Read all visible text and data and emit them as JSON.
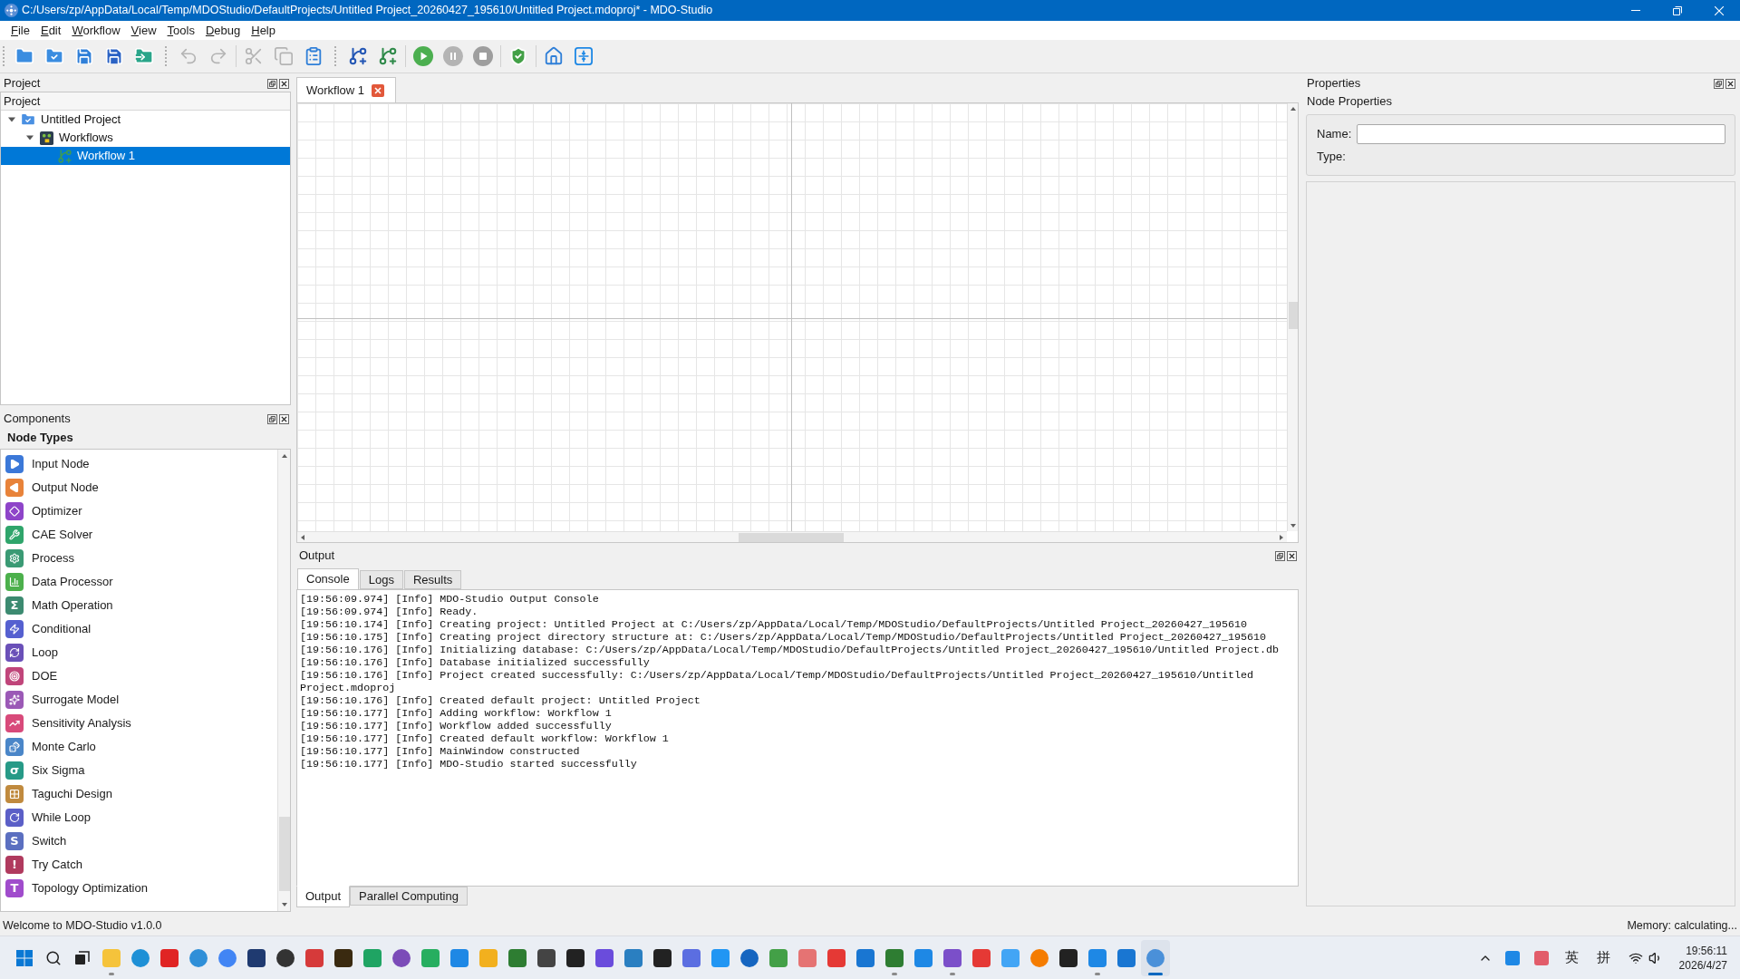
{
  "window": {
    "title": "C:/Users/zp/AppData/Local/Temp/MDOStudio/DefaultProjects/Untitled Project_20260427_195610/Untitled Project.mdoproj* - MDO-Studio"
  },
  "menu": [
    "File",
    "Edit",
    "Workflow",
    "View",
    "Tools",
    "Debug",
    "Help"
  ],
  "toolbar": [
    [
      {
        "kind": "new-project",
        "disabled": false
      },
      {
        "kind": "open-project",
        "disabled": false
      },
      {
        "kind": "save",
        "disabled": false
      },
      {
        "kind": "save-as",
        "disabled": false
      },
      {
        "kind": "export",
        "disabled": false
      }
    ],
    [
      {
        "kind": "undo",
        "disabled": true
      },
      {
        "kind": "redo",
        "disabled": true
      }
    ],
    [
      {
        "kind": "cut",
        "disabled": true
      },
      {
        "kind": "copy",
        "disabled": true
      },
      {
        "kind": "paste",
        "disabled": false
      }
    ],
    [
      {
        "kind": "add-workflow",
        "disabled": false
      },
      {
        "kind": "add-subworkflow",
        "disabled": false
      }
    ],
    [
      {
        "kind": "run",
        "disabled": false
      },
      {
        "kind": "pause",
        "disabled": true
      },
      {
        "kind": "stop",
        "disabled": true
      }
    ],
    [
      {
        "kind": "validate",
        "disabled": false
      }
    ],
    [
      {
        "kind": "home",
        "disabled": false
      },
      {
        "kind": "fit-view",
        "disabled": false
      }
    ]
  ],
  "project_panel": {
    "title": "Project",
    "column": "Project",
    "tree": [
      {
        "label": "Untitled Project",
        "expanded": true,
        "selected": false,
        "children": [
          {
            "label": "Workflows",
            "expanded": true,
            "selected": false,
            "children": [
              {
                "label": "Workflow 1",
                "selected": true
              }
            ]
          }
        ]
      }
    ]
  },
  "components_panel": {
    "title": "Components",
    "heading": "Node Types",
    "items": [
      {
        "label": "Input Node",
        "color": "#3b78d8"
      },
      {
        "label": "Output Node",
        "color": "#e8833a"
      },
      {
        "label": "Optimizer",
        "color": "#8e44c9"
      },
      {
        "label": "CAE Solver",
        "color": "#2fa56b"
      },
      {
        "label": "Process",
        "color": "#3a9a74"
      },
      {
        "label": "Data Processor",
        "color": "#4cb04c"
      },
      {
        "label": "Math Operation",
        "color": "#3c8a70",
        "glyph": "Σ"
      },
      {
        "label": "Conditional",
        "color": "#5560d0"
      },
      {
        "label": "Loop",
        "color": "#6a50b8"
      },
      {
        "label": "DOE",
        "color": "#c0457a"
      },
      {
        "label": "Surrogate Model",
        "color": "#9b59b6"
      },
      {
        "label": "Sensitivity Analysis",
        "color": "#d84a7a"
      },
      {
        "label": "Monte Carlo",
        "color": "#4a86c8"
      },
      {
        "label": "Six Sigma",
        "color": "#279a87",
        "glyph": "σ"
      },
      {
        "label": "Taguchi Design",
        "color": "#c08a3e"
      },
      {
        "label": "While Loop",
        "color": "#5b5fc7"
      },
      {
        "label": "Switch",
        "color": "#5b6fc0",
        "glyph": "S"
      },
      {
        "label": "Try Catch",
        "color": "#b03a5e",
        "glyph": "!"
      },
      {
        "label": "Topology Optimization",
        "color": "#a04ccc",
        "glyph": "T"
      }
    ]
  },
  "editor_tabs": [
    {
      "label": "Workflow 1",
      "selected": true
    }
  ],
  "output_panel": {
    "title": "Output",
    "tabs": [
      {
        "label": "Console",
        "selected": true
      },
      {
        "label": "Logs",
        "selected": false
      },
      {
        "label": "Results",
        "selected": false
      }
    ],
    "console_lines": [
      "[19:56:09.974] [Info] MDO-Studio Output Console",
      "[19:56:09.974] [Info] Ready.",
      "[19:56:10.174] [Info] Creating project: Untitled Project at C:/Users/zp/AppData/Local/Temp/MDOStudio/DefaultProjects/Untitled Project_20260427_195610",
      "[19:56:10.175] [Info] Creating project directory structure at: C:/Users/zp/AppData/Local/Temp/MDOStudio/DefaultProjects/Untitled Project_20260427_195610",
      "[19:56:10.176] [Info] Initializing database: C:/Users/zp/AppData/Local/Temp/MDOStudio/DefaultProjects/Untitled Project_20260427_195610/Untitled Project.db",
      "[19:56:10.176] [Info] Database initialized successfully",
      "[19:56:10.176] [Info] Project created successfully: C:/Users/zp/AppData/Local/Temp/MDOStudio/DefaultProjects/Untitled Project_20260427_195610/Untitled Project.mdoproj",
      "[19:56:10.176] [Info] Created default project: Untitled Project",
      "[19:56:10.177] [Info] Adding workflow: Workflow 1",
      "[19:56:10.177] [Info] Workflow added successfully",
      "[19:56:10.177] [Info] Created default workflow: Workflow 1",
      "[19:56:10.177] [Info] MainWindow constructed",
      "[19:56:10.177] [Info] MDO-Studio started successfully"
    ],
    "bottom_tabs": [
      {
        "label": "Output",
        "selected": true
      },
      {
        "label": "Parallel Computing",
        "selected": false
      }
    ]
  },
  "properties_panel": {
    "title": "Properties",
    "group": "Node Properties",
    "fields": [
      {
        "label": "Name:",
        "kind": "input"
      },
      {
        "label": "Type:",
        "kind": "text"
      }
    ]
  },
  "status_bar": {
    "message": "Welcome to MDO-Studio v1.0.0",
    "memory": "Memory: calculating..."
  },
  "taskbar": {
    "apps": [
      {
        "running": true,
        "selected": false
      },
      {
        "running": false,
        "selected": false
      },
      {
        "running": false,
        "selected": false
      },
      {
        "running": false,
        "selected": false
      },
      {
        "running": false,
        "selected": false
      },
      {
        "running": false,
        "selected": false
      },
      {
        "running": false,
        "selected": false
      },
      {
        "running": false,
        "selected": false
      },
      {
        "running": false,
        "selected": false
      },
      {
        "running": false,
        "selected": false
      },
      {
        "running": false,
        "selected": false
      },
      {
        "running": false,
        "selected": false
      },
      {
        "running": false,
        "selected": false
      },
      {
        "running": false,
        "selected": false
      },
      {
        "running": false,
        "selected": false
      },
      {
        "running": false,
        "selected": false
      },
      {
        "running": false,
        "selected": false
      },
      {
        "running": false,
        "selected": false
      },
      {
        "running": false,
        "selected": false
      },
      {
        "running": false,
        "selected": false
      },
      {
        "running": false,
        "selected": false
      },
      {
        "running": false,
        "selected": false
      },
      {
        "running": false,
        "selected": false
      },
      {
        "running": false,
        "selected": false
      },
      {
        "running": false,
        "selected": false
      },
      {
        "running": false,
        "selected": false
      },
      {
        "running": false,
        "selected": false
      },
      {
        "running": true,
        "selected": false
      },
      {
        "running": false,
        "selected": false
      },
      {
        "running": true,
        "selected": false
      },
      {
        "running": false,
        "selected": false
      },
      {
        "running": false,
        "selected": false
      },
      {
        "running": false,
        "selected": false
      },
      {
        "running": false,
        "selected": false
      },
      {
        "running": true,
        "selected": false
      },
      {
        "running": false,
        "selected": false
      },
      {
        "running": true,
        "selected": true
      }
    ],
    "ime": [
      "英",
      "拼"
    ],
    "clock": {
      "time": "19:56:11",
      "date": "2026/4/27"
    }
  }
}
